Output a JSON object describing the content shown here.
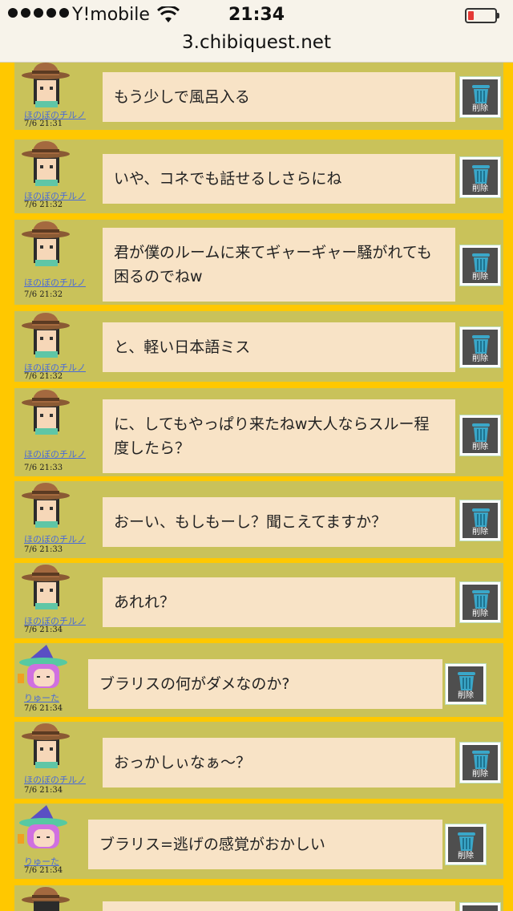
{
  "status_bar": {
    "carrier": "Y!mobile",
    "time": "21:34"
  },
  "browser": {
    "url": "3.chibiquest.net"
  },
  "delete_label": "削除",
  "messages": [
    {
      "user": "ほのぼのチルノ",
      "time": "7/6 21:31",
      "text": "もう少しで風呂入る",
      "avatar": "cowboy-hat-avatar"
    },
    {
      "user": "ほのぼのチルノ",
      "time": "7/6 21:32",
      "text": "いや、コネでも話せるしさらにね",
      "avatar": "cowboy-hat-avatar"
    },
    {
      "user": "ほのぼのチルノ",
      "time": "7/6 21:32",
      "text": "君が僕のルームに来てギャーギャー騒がれても困るのでねw",
      "avatar": "cowboy-hat-avatar"
    },
    {
      "user": "ほのぼのチルノ",
      "time": "7/6 21:32",
      "text": "と、軽い日本語ミス",
      "avatar": "cowboy-hat-avatar"
    },
    {
      "user": "ほのぼのチルノ",
      "time": "7/6 21:33",
      "text": "に、してもやっぱり来たねw大人ならスルー程度したら？",
      "avatar": "cowboy-hat-avatar"
    },
    {
      "user": "ほのぼのチルノ",
      "time": "7/6 21:33",
      "text": "おーい、もしもーし？聞こえてますか？",
      "avatar": "cowboy-hat-avatar"
    },
    {
      "user": "ほのぼのチルノ",
      "time": "7/6 21:34",
      "text": "あれれ？",
      "avatar": "cowboy-hat-avatar"
    },
    {
      "user": "りゅーた",
      "time": "7/6 21:34",
      "text": "ブラリスの何がダメなのか?",
      "avatar": "witch-hat-avatar"
    },
    {
      "user": "ほのぼのチルノ",
      "time": "7/6 21:34",
      "text": "おっかしぃなぁ～？",
      "avatar": "cowboy-hat-avatar"
    },
    {
      "user": "りゅーた",
      "time": "7/6 21:34",
      "text": "ブラリス=逃げの感覚がおかしい",
      "avatar": "witch-hat-avatar"
    }
  ]
}
